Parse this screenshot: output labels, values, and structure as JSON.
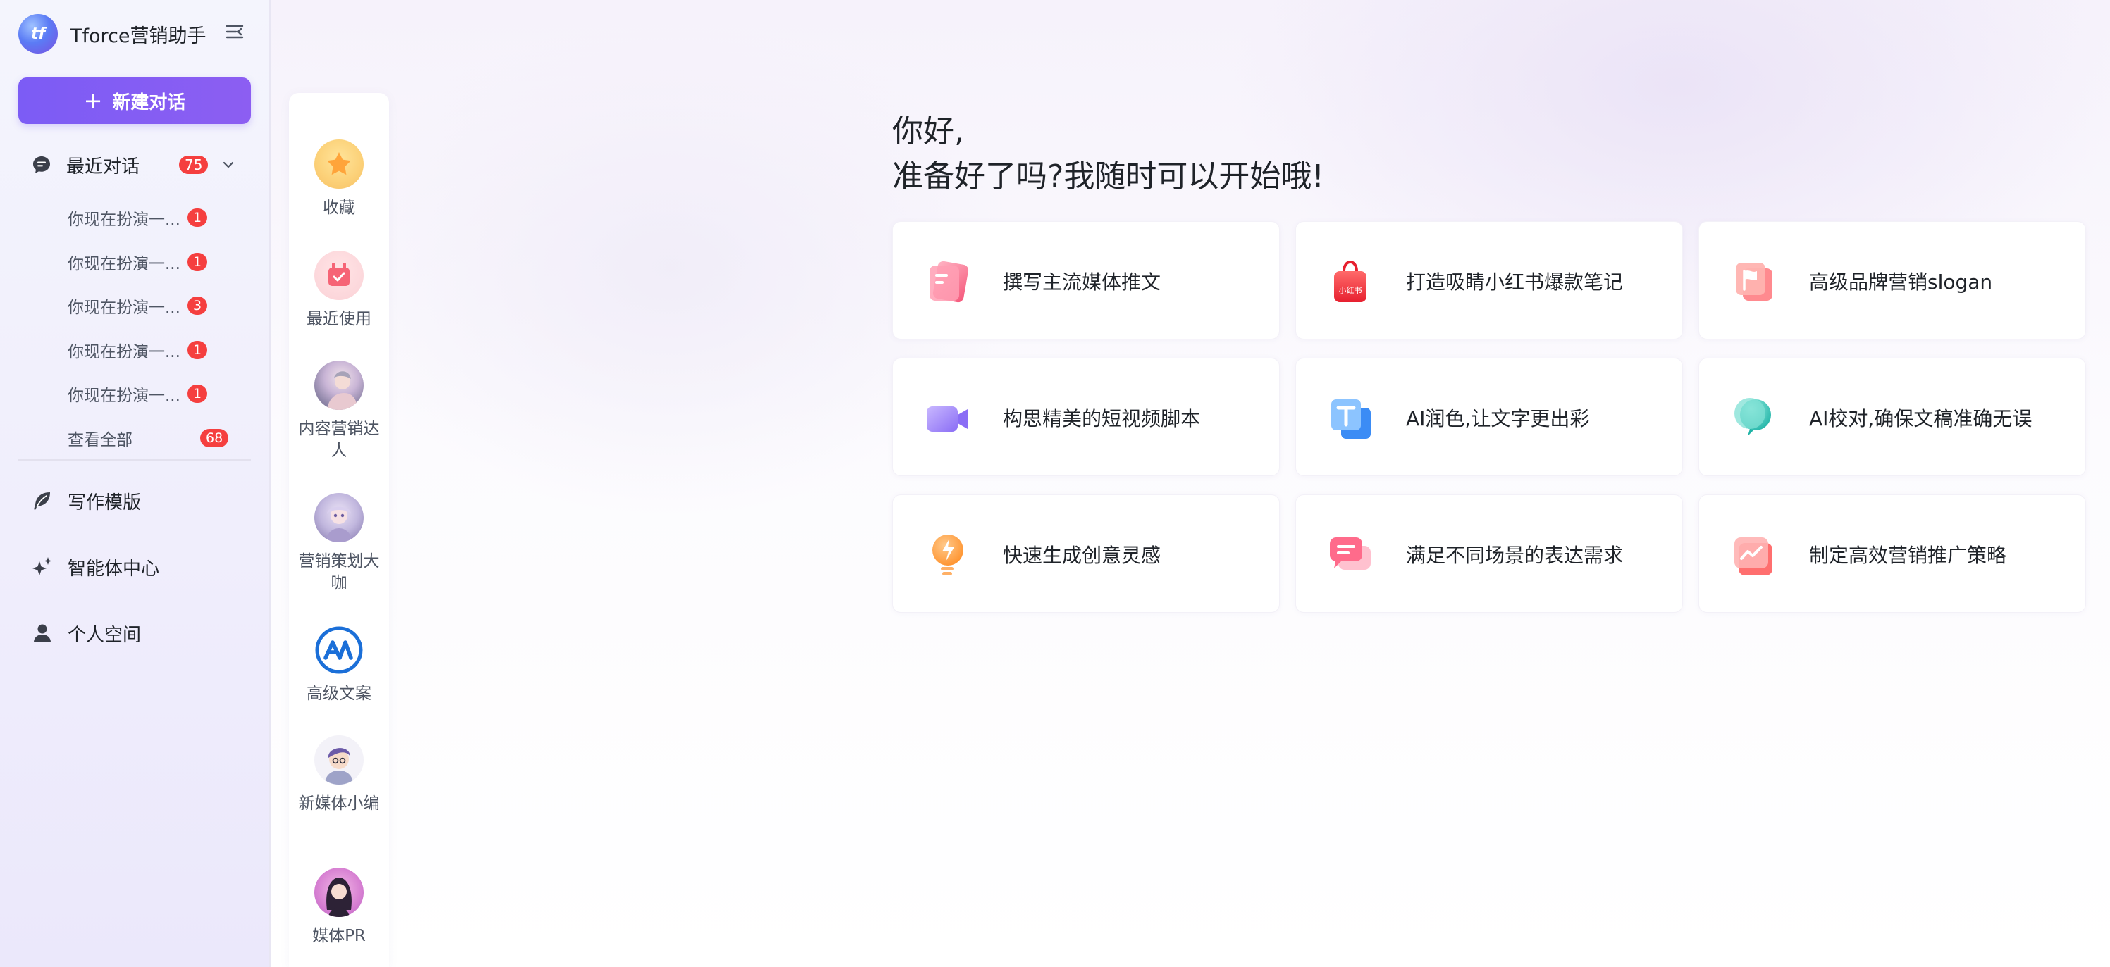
{
  "app": {
    "title": "Tforce营销助手",
    "logo_text": "tf"
  },
  "sidebar": {
    "new_chat_label": "新建对话",
    "recent": {
      "label": "最近对话",
      "count": "75"
    },
    "conversations": [
      {
        "title": "你现在扮演一...",
        "badge": "1"
      },
      {
        "title": "你现在扮演一...",
        "badge": "1"
      },
      {
        "title": "你现在扮演一...",
        "badge": "3"
      },
      {
        "title": "你现在扮演一...",
        "badge": "1"
      },
      {
        "title": "你现在扮演一...",
        "badge": "1"
      }
    ],
    "view_all": {
      "label": "查看全部",
      "count": "68"
    },
    "nav": [
      {
        "label": "写作模版",
        "icon": "leaf-icon"
      },
      {
        "label": "智能体中心",
        "icon": "sparkle-icon"
      },
      {
        "label": "个人空间",
        "icon": "user-icon"
      }
    ]
  },
  "agents": [
    {
      "name": "收藏",
      "icon": "star-icon"
    },
    {
      "name": "最近使用",
      "icon": "recent-bag-icon"
    },
    {
      "name": "内容营销达人",
      "icon": "avatar"
    },
    {
      "name": "营销策划大咖",
      "icon": "avatar"
    },
    {
      "name": "高级文案",
      "icon": "ai-logo-icon"
    },
    {
      "name": "新媒体小编",
      "icon": "avatar"
    },
    {
      "name": "媒体PR",
      "icon": "avatar"
    }
  ],
  "main": {
    "greeting_line1": "你好,",
    "greeting_line2": "准备好了吗?我随时可以开始哦!",
    "cards": [
      {
        "label": "撰写主流媒体推文",
        "icon": "document-icon"
      },
      {
        "label": "打造吸睛小红书爆款笔记",
        "icon": "shopping-bag-icon",
        "icon_text": "小红书"
      },
      {
        "label": "高级品牌营销slogan",
        "icon": "flag-icon"
      },
      {
        "label": "构思精美的短视频脚本",
        "icon": "video-camera-icon"
      },
      {
        "label": "AI润色,让文字更出彩",
        "icon": "text-t-icon"
      },
      {
        "label": "AI校对,确保文稿准确无误",
        "icon": "balloon-icon"
      },
      {
        "label": "快速生成创意灵感",
        "icon": "lightbulb-icon"
      },
      {
        "label": "满足不同场景的表达需求",
        "icon": "chat-bubble-icon"
      },
      {
        "label": "制定高效营销推广策略",
        "icon": "trend-chart-icon"
      }
    ]
  },
  "colors": {
    "accent": "#7c5cf5",
    "badge": "#f53f3f"
  }
}
